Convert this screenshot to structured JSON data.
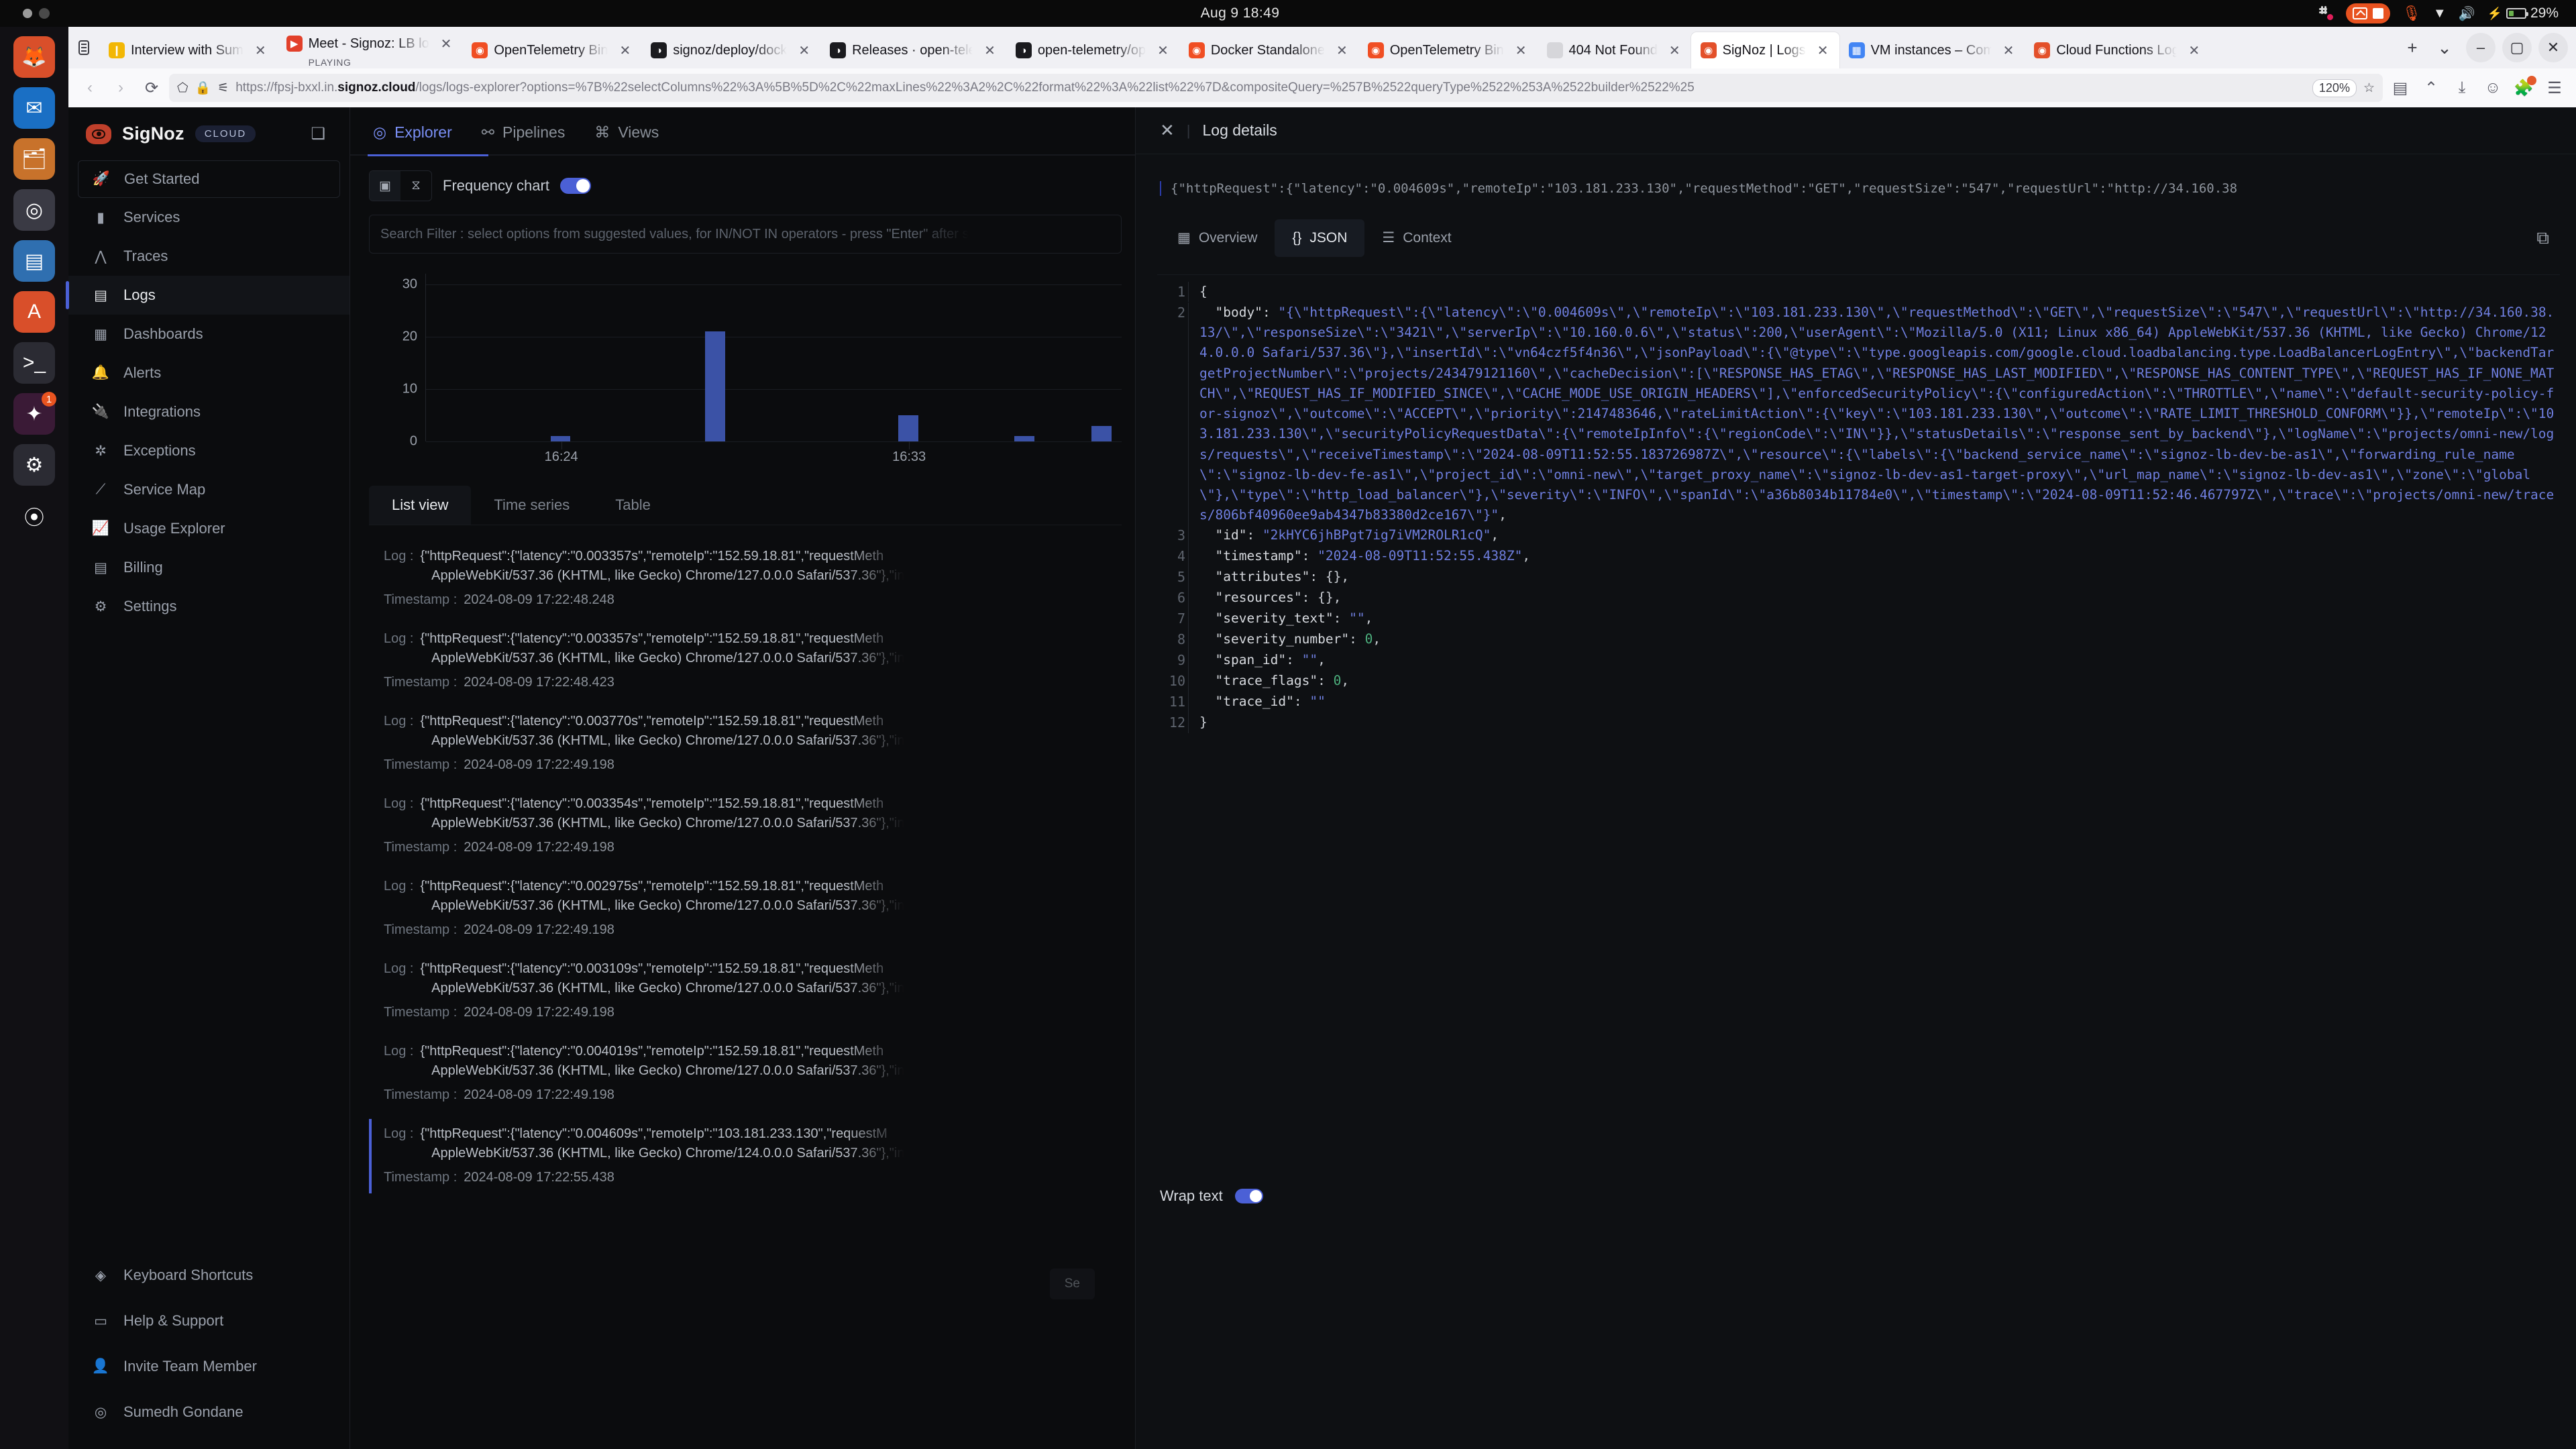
{
  "os_bar": {
    "clock": "Aug 9  18:49",
    "battery": "29%",
    "icons": [
      "slack-icon",
      "screen-record-icon",
      "stop-record-icon",
      "microphone-icon",
      "wifi-icon",
      "volume-icon",
      "battery-icon"
    ]
  },
  "dock": {
    "items": [
      {
        "name": "firefox",
        "glyph": "🦊",
        "bg": "#d94f2a"
      },
      {
        "name": "thunderbird",
        "glyph": "✉",
        "bg": "#1a6fc4"
      },
      {
        "name": "files",
        "glyph": "🗂",
        "bg": "#c8722b"
      },
      {
        "name": "rhythmbox",
        "glyph": "◎",
        "bg": "#3a3a44"
      },
      {
        "name": "libreoffice",
        "glyph": "▤",
        "bg": "#2f6fb0"
      },
      {
        "name": "app-center",
        "glyph": "A",
        "bg": "#d94f2a"
      },
      {
        "name": "terminal",
        "glyph": ">_",
        "bg": "#2b2b33"
      },
      {
        "name": "slack",
        "glyph": "✦",
        "bg": "#3a1a36",
        "badge": "1"
      },
      {
        "name": "settings",
        "glyph": "⚙",
        "bg": "#2b2b33"
      },
      {
        "name": "show-apps",
        "glyph": "⦿",
        "bg": "transparent"
      }
    ]
  },
  "browser": {
    "tabs": [
      {
        "title": "Interview with Sum",
        "favicon": "bookmark",
        "color": "#f2b705",
        "active": false
      },
      {
        "title": "Meet - Signoz: LB lo",
        "favicon": "meet",
        "color": "#e2402a",
        "active": false,
        "playing": true,
        "playing_label": "PLAYING"
      },
      {
        "title": "OpenTelemetry Bin",
        "favicon": "otel",
        "color": "#f04e23",
        "active": false
      },
      {
        "title": "signoz/deploy/dock",
        "favicon": "github",
        "color": "#1b1b1f",
        "active": false
      },
      {
        "title": "Releases · open-tele",
        "favicon": "github",
        "color": "#1b1b1f",
        "active": false
      },
      {
        "title": "open-telemetry/op",
        "favicon": "github",
        "color": "#1b1b1f",
        "active": false
      },
      {
        "title": "Docker Standalone",
        "favicon": "otel",
        "color": "#f04e23",
        "active": false
      },
      {
        "title": "OpenTelemetry Bin",
        "favicon": "otel",
        "color": "#f04e23",
        "active": false
      },
      {
        "title": "404 Not Found",
        "favicon": "blank",
        "color": "#d6d6da",
        "active": false
      },
      {
        "title": "SigNoz | Logs",
        "favicon": "signoz",
        "color": "#e3502a",
        "active": true
      },
      {
        "title": "VM instances – Com",
        "favicon": "gcp",
        "color": "#4285f4",
        "active": false
      },
      {
        "title": "Cloud Functions Log",
        "favicon": "signoz",
        "color": "#e3502a",
        "active": false
      }
    ],
    "new_tab_label": "+",
    "tab_list_label": "⌄",
    "window_controls": [
      "minimize",
      "maximize",
      "close"
    ],
    "url": "https://fpsj-bxxl.in.signoz.cloud/logs/logs-explorer?options=%7B%22selectColumns%22%3A%5B%5D%2C%22maxLines%22%3A2%2C%22format%22%3A%22list%22%7D&compositeQuery=%257B%2522queryType%2522%253A%2522builder%2522%25",
    "url_domain": "signoz.cloud",
    "url_prefix": "https://fpsj-bxxl.in.",
    "zoom_level": "120%",
    "nav_icons": [
      "back-icon",
      "forward-icon",
      "reload-icon",
      "shield-icon",
      "lock-icon",
      "reader-icon",
      "bookmark-star-icon",
      "save-to-pocket-icon",
      "downloads-icon",
      "account-icon",
      "extensions-icon",
      "menu-icon"
    ]
  },
  "sidebar": {
    "brand": "SigNoz",
    "plan_chip": "CLOUD",
    "items": [
      {
        "label": "Get Started",
        "icon": "rocket-icon",
        "boxed": true
      },
      {
        "label": "Services",
        "icon": "bar-chart-icon"
      },
      {
        "label": "Traces",
        "icon": "traces-icon"
      },
      {
        "label": "Logs",
        "icon": "logs-icon",
        "active": true
      },
      {
        "label": "Dashboards",
        "icon": "grid-icon"
      },
      {
        "label": "Alerts",
        "icon": "bell-icon"
      },
      {
        "label": "Integrations",
        "icon": "plug-icon"
      },
      {
        "label": "Exceptions",
        "icon": "bug-icon"
      },
      {
        "label": "Service Map",
        "icon": "service-map-icon"
      },
      {
        "label": "Usage Explorer",
        "icon": "usage-icon"
      },
      {
        "label": "Billing",
        "icon": "billing-icon"
      },
      {
        "label": "Settings",
        "icon": "gear-icon"
      }
    ],
    "bottom_items": [
      {
        "label": "Keyboard Shortcuts",
        "icon": "layers-icon"
      },
      {
        "label": "Help & Support",
        "icon": "chat-icon"
      },
      {
        "label": "Invite Team Member",
        "icon": "user-plus-icon"
      },
      {
        "label": "Sumedh Gondane",
        "icon": "avatar-icon"
      }
    ]
  },
  "explorer": {
    "tabs": [
      {
        "label": "Explorer",
        "icon": "compass-icon",
        "active": true
      },
      {
        "label": "Pipelines",
        "icon": "pipeline-icon",
        "active": false
      },
      {
        "label": "Views",
        "icon": "views-icon",
        "active": false
      }
    ],
    "frequency_chart_label": "Frequency chart",
    "frequency_chart_on": true,
    "search_placeholder": "Search Filter : select options from suggested values, for IN/NOT IN operators - press \"Enter\" after s",
    "view_tabs": [
      {
        "label": "List view",
        "active": true
      },
      {
        "label": "Time series",
        "active": false
      },
      {
        "label": "Table",
        "active": false
      }
    ],
    "fade_button": "Se"
  },
  "chart_data": {
    "type": "bar",
    "title": "",
    "xlabel": "",
    "ylabel": "",
    "ylim": [
      0,
      32
    ],
    "yticks": [
      0,
      10,
      20,
      30
    ],
    "xticks": [
      "16:24",
      "16:33"
    ],
    "grid": true,
    "legend": "none",
    "categories": [
      "16:21",
      "16:22",
      "16:23",
      "16:24",
      "16:25",
      "16:26",
      "16:27",
      "16:28",
      "16:29",
      "16:30",
      "16:31",
      "16:32",
      "16:33",
      "16:34",
      "16:35",
      "16:36",
      "16:37",
      "16:38"
    ],
    "values": [
      0,
      0,
      0,
      1,
      0,
      0,
      0,
      21,
      0,
      0,
      0,
      0,
      5,
      0,
      0,
      1,
      0,
      3
    ]
  },
  "log_rows": [
    {
      "log": "{\"httpRequest\":{\"latency\":\"0.004609s\",\"remoteIp\":\"103.181.233.130\",\"requestM\n   AppleWebKit/537.36 (KHTML, like Gecko) Chrome/124.0.0.0 Safari/537.36\"},\"in",
      "timestamp": "2024-08-09 17:22:55.438",
      "selected": true
    },
    {
      "log": "{\"httpRequest\":{\"latency\":\"0.004019s\",\"remoteIp\":\"152.59.18.81\",\"requestMeth\n   AppleWebKit/537.36 (KHTML, like Gecko) Chrome/127.0.0.0 Safari/537.36\"},\"in",
      "timestamp": "2024-08-09 17:22:49.198",
      "selected": false
    },
    {
      "log": "{\"httpRequest\":{\"latency\":\"0.003109s\",\"remoteIp\":\"152.59.18.81\",\"requestMeth\n   AppleWebKit/537.36 (KHTML, like Gecko) Chrome/127.0.0.0 Safari/537.36\"},\"in",
      "timestamp": "2024-08-09 17:22:49.198",
      "selected": false
    },
    {
      "log": "{\"httpRequest\":{\"latency\":\"0.002975s\",\"remoteIp\":\"152.59.18.81\",\"requestMeth\n   AppleWebKit/537.36 (KHTML, like Gecko) Chrome/127.0.0.0 Safari/537.36\"},\"in",
      "timestamp": "2024-08-09 17:22:49.198",
      "selected": false
    },
    {
      "log": "{\"httpRequest\":{\"latency\":\"0.003354s\",\"remoteIp\":\"152.59.18.81\",\"requestMeth\n   AppleWebKit/537.36 (KHTML, like Gecko) Chrome/127.0.0.0 Safari/537.36\"},\"in",
      "timestamp": "2024-08-09 17:22:49.198",
      "selected": false
    },
    {
      "log": "{\"httpRequest\":{\"latency\":\"0.003770s\",\"remoteIp\":\"152.59.18.81\",\"requestMeth\n   AppleWebKit/537.36 (KHTML, like Gecko) Chrome/127.0.0.0 Safari/537.36\"},\"in",
      "timestamp": "2024-08-09 17:22:49.198",
      "selected": false
    },
    {
      "log": "{\"httpRequest\":{\"latency\":\"0.003357s\",\"remoteIp\":\"152.59.18.81\",\"requestMeth\n   AppleWebKit/537.36 (KHTML, like Gecko) Chrome/127.0.0.0 Safari/537.36\"},\"in",
      "timestamp": "2024-08-09 17:22:48.423",
      "selected": false
    },
    {
      "log": "{\"httpRequest\":{\"latency\":\"0.003357s\",\"remoteIp\":\"152.59.18.81\",\"requestMeth\n   AppleWebKit/537.36 (KHTML, like Gecko) Chrome/127.0.0.0 Safari/537.36\"},\"in",
      "timestamp": "2024-08-09 17:22:48.248",
      "selected": false
    }
  ],
  "drawer": {
    "title": "Log details",
    "close_icon": "close-icon",
    "body_preview": "{\"httpRequest\":{\"latency\":\"0.004609s\",\"remoteIp\":\"103.181.233.130\",\"requestMethod\":\"GET\",\"requestSize\":\"547\",\"requestUrl\":\"http://34.160.38",
    "tabs": [
      {
        "label": "Overview",
        "icon": "table-icon",
        "active": false
      },
      {
        "label": "JSON",
        "icon": "braces-icon",
        "active": true
      },
      {
        "label": "Context",
        "icon": "list-icon",
        "active": false
      }
    ],
    "copy_icon": "copy-icon",
    "wrap_text_label": "Wrap text",
    "wrap_text_on": true,
    "code_lines": [
      {
        "n": 1,
        "text": "{"
      },
      {
        "n": 2,
        "text": "  \"body\": \"{\\\"httpRequest\\\":{\\\"latency\\\":\\\"0.004609s\\\",\\\"remoteIp\\\":\\\"103.181.233.130\\\",\\\"requestMethod\\\":\\\"GET\\\",\\\"requestSize\\\":\\\"547\\\",\\\"requestUrl\\\":\\\"http://34.160.38.13/\\\",\\\"responseSize\\\":\\\"3421\\\",\\\"serverIp\\\":\\\"10.160.0.6\\\",\\\"status\\\":200,\\\"userAgent\\\":\\\"Mozilla/5.0 (X11; Linux x86_64) AppleWebKit/537.36 (KHTML, like Gecko) Chrome/124.0.0.0 Safari/537.36\\\"},\\\"insertId\\\":\\\"vn64czf5f4n36\\\",\\\"jsonPayload\\\":{\\\"@type\\\":\\\"type.googleapis.com/google.cloud.loadbalancing.type.LoadBalancerLogEntry\\\",\\\"backendTargetProjectNumber\\\":\\\"projects/243479121160\\\",\\\"cacheDecision\\\":[\\\"RESPONSE_HAS_ETAG\\\",\\\"RESPONSE_HAS_LAST_MODIFIED\\\",\\\"RESPONSE_HAS_CONTENT_TYPE\\\",\\\"REQUEST_HAS_IF_NONE_MATCH\\\",\\\"REQUEST_HAS_IF_MODIFIED_SINCE\\\",\\\"CACHE_MODE_USE_ORIGIN_HEADERS\\\"],\\\"enforcedSecurityPolicy\\\":{\\\"configuredAction\\\":\\\"THROTTLE\\\",\\\"name\\\":\\\"default-security-policy-for-signoz\\\",\\\"outcome\\\":\\\"ACCEPT\\\",\\\"priority\\\":2147483646,\\\"rateLimitAction\\\":{\\\"key\\\":\\\"103.181.233.130\\\",\\\"outcome\\\":\\\"RATE_LIMIT_THRESHOLD_CONFORM\\\"}},\\\"remoteIp\\\":\\\"103.181.233.130\\\",\\\"securityPolicyRequestData\\\":{\\\"remoteIpInfo\\\":{\\\"regionCode\\\":\\\"IN\\\"}},\\\"statusDetails\\\":\\\"response_sent_by_backend\\\"},\\\"logName\\\":\\\"projects/omni-new/logs/requests\\\",\\\"receiveTimestamp\\\":\\\"2024-08-09T11:52:55.183726987Z\\\",\\\"resource\\\":{\\\"labels\\\":{\\\"backend_service_name\\\":\\\"signoz-lb-dev-be-as1\\\",\\\"forwarding_rule_name\\\":\\\"signoz-lb-dev-fe-as1\\\",\\\"project_id\\\":\\\"omni-new\\\",\\\"target_proxy_name\\\":\\\"signoz-lb-dev-as1-target-proxy\\\",\\\"url_map_name\\\":\\\"signoz-lb-dev-as1\\\",\\\"zone\\\":\\\"global\\\"},\\\"type\\\":\\\"http_load_balancer\\\"},\\\"severity\\\":\\\"INFO\\\",\\\"spanId\\\":\\\"a36b8034b11784e0\\\",\\\"timestamp\\\":\\\"2024-08-09T11:52:46.467797Z\\\",\\\"trace\\\":\\\"projects/omni-new/traces/806bf40960ee9ab4347b83380d2ce167\\\"}\","
      },
      {
        "n": 3,
        "text": "  \"id\": \"2kHYC6jhBPgt7ig7iVM2ROLR1cQ\","
      },
      {
        "n": 4,
        "text": "  \"timestamp\": \"2024-08-09T11:52:55.438Z\","
      },
      {
        "n": 5,
        "text": "  \"attributes\": {},"
      },
      {
        "n": 6,
        "text": "  \"resources\": {},"
      },
      {
        "n": 7,
        "text": "  \"severity_text\": \"\","
      },
      {
        "n": 8,
        "text": "  \"severity_number\": 0,"
      },
      {
        "n": 9,
        "text": "  \"span_id\": \"\","
      },
      {
        "n": 10,
        "text": "  \"trace_flags\": 0,"
      },
      {
        "n": 11,
        "text": "  \"trace_id\": \"\""
      },
      {
        "n": 12,
        "text": "}"
      }
    ]
  },
  "colors": {
    "accent_blue": "#4b60d6",
    "brand_orange": "#e3502a",
    "bar_blue": "#3b52a6",
    "json_string": "#6f7fe0",
    "json_number": "#4caf7d"
  }
}
